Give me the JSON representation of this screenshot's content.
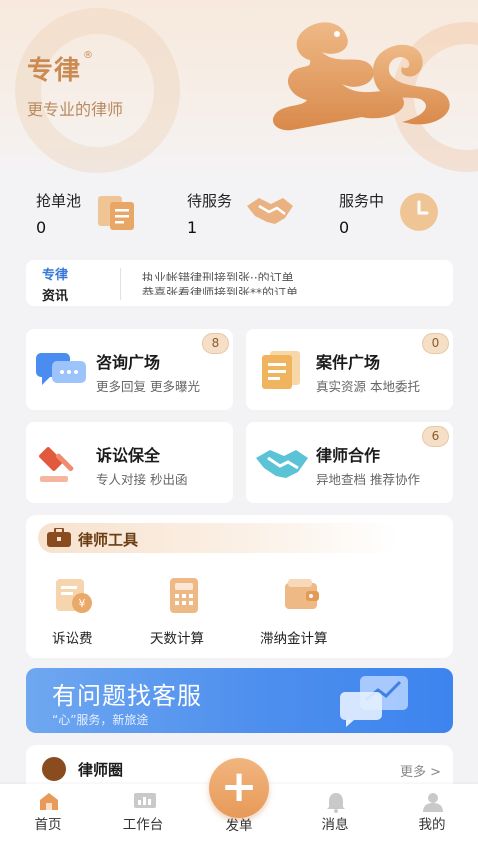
{
  "hero": {
    "brand": "专律",
    "reg_mark": "®",
    "slogan": "更专业的律师"
  },
  "stats": [
    {
      "label": "抢单池",
      "value": "0",
      "icon": "order-pool-icon"
    },
    {
      "label": "待服务",
      "value": "1",
      "icon": "handshake-icon"
    },
    {
      "label": "服务中",
      "value": "0",
      "icon": "clock-icon"
    }
  ],
  "news": {
    "title_line1": "专律",
    "title_line2": "资讯",
    "lines": [
      "执业帐错律刑接到张··的订单",
      "恭喜张看律师接到张**的订单"
    ]
  },
  "cards": [
    {
      "title": "咨询广场",
      "subtitle": "更多回复 更多曝光",
      "badge": "8",
      "icon": "chat-bubbles-icon"
    },
    {
      "title": "案件广场",
      "subtitle": "真实资源 本地委托",
      "badge": "0",
      "icon": "document-icon"
    },
    {
      "title": "诉讼保全",
      "subtitle": "专人对接 秒出函",
      "badge": "",
      "icon": "gavel-icon"
    },
    {
      "title": "律师合作",
      "subtitle": "异地查档 推荐协作",
      "badge": "6",
      "icon": "cooperation-icon"
    }
  ],
  "tools": {
    "title": "律师工具",
    "items": [
      {
        "label": "诉讼费",
        "icon": "litigation-fee-icon"
      },
      {
        "label": "天数计算",
        "icon": "calculator-icon"
      },
      {
        "label": "滞纳金计算",
        "icon": "wallet-icon"
      }
    ]
  },
  "banner": {
    "title": "有问题找客服",
    "subtitle": "“心”服务，新旅途"
  },
  "circle": {
    "title": "律师圈",
    "more": "更多 >"
  },
  "tabbar": {
    "items": [
      {
        "label": "首页",
        "icon": "home-icon",
        "active": true
      },
      {
        "label": "工作台",
        "icon": "workbench-icon",
        "active": false
      },
      {
        "label": "发单",
        "icon": "plus-icon",
        "active": false
      },
      {
        "label": "消息",
        "icon": "bell-icon",
        "active": false
      },
      {
        "label": "我的",
        "icon": "profile-icon",
        "active": false
      }
    ],
    "fab_symbol": "+"
  },
  "colors": {
    "accent": "#e79a59",
    "brand": "#c98b52",
    "link_blue": "#3978d6",
    "banner_blue": "#4d8fee"
  }
}
